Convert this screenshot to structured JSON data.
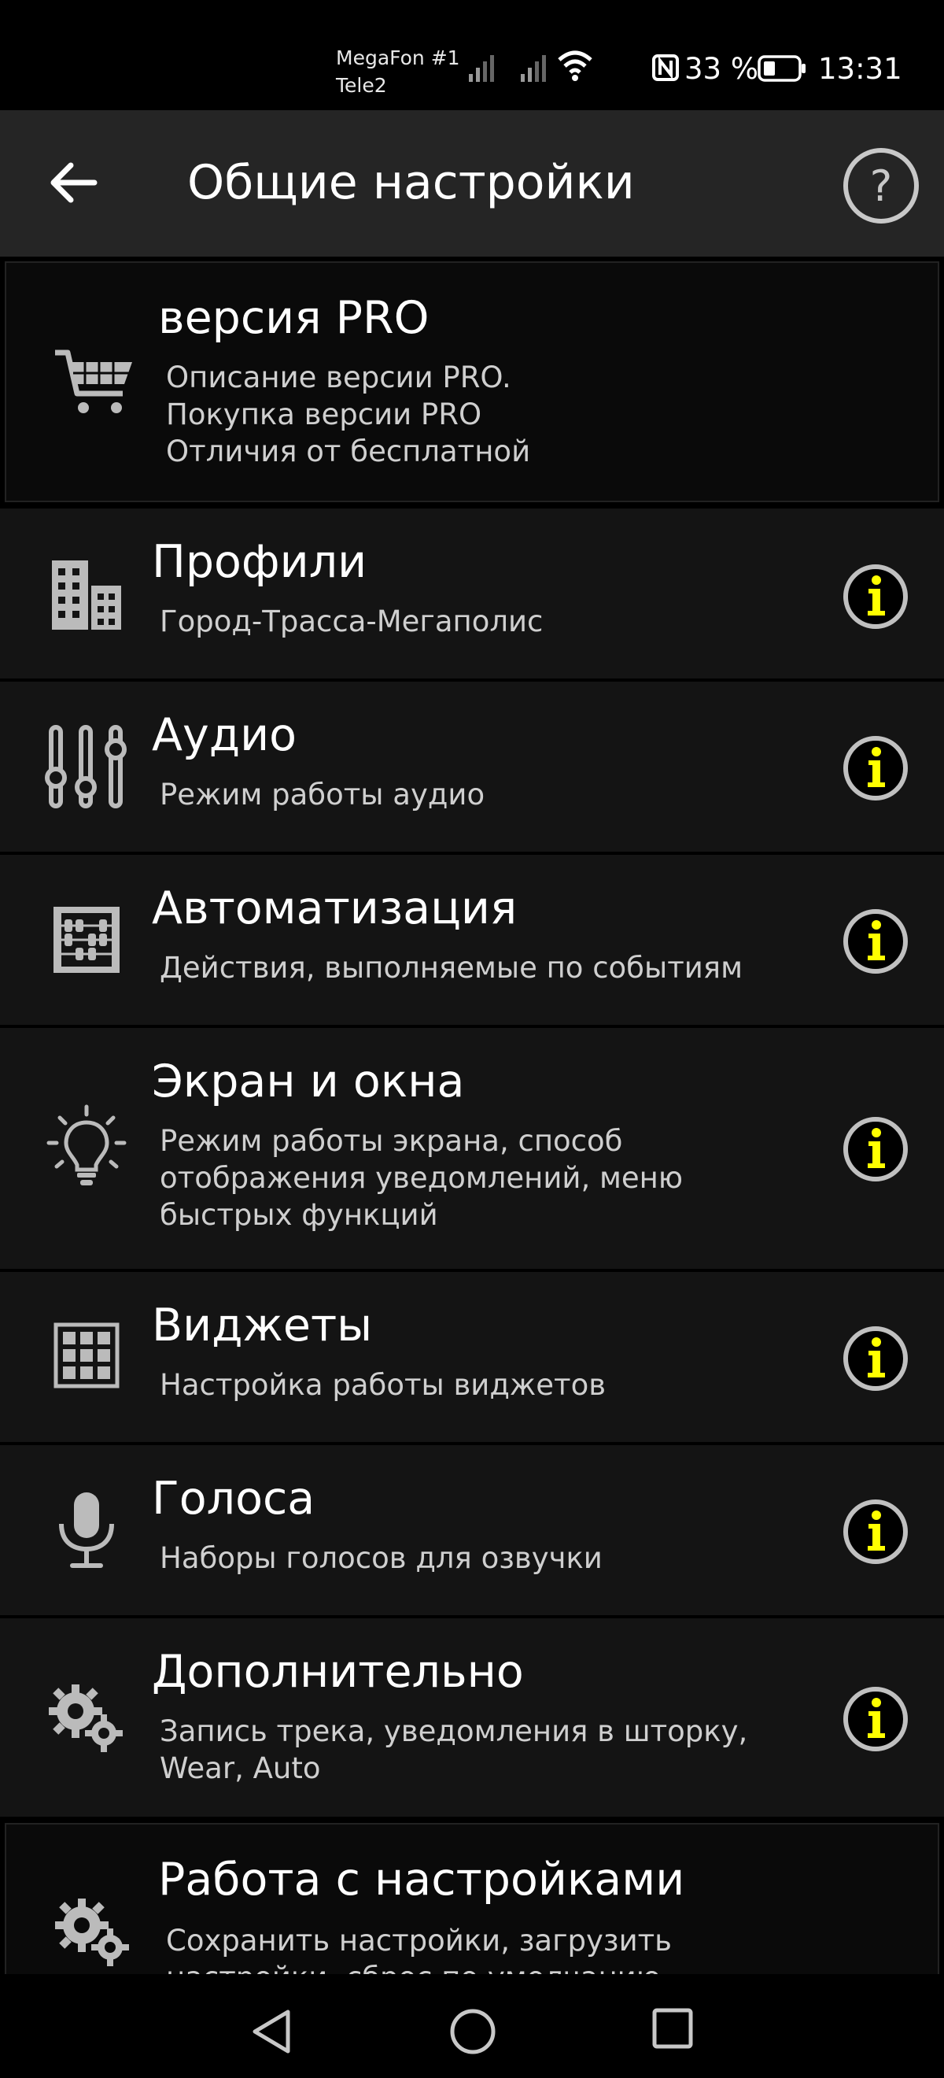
{
  "status_bar": {
    "carrier1": "MegaFon #1",
    "carrier2": "Tele2",
    "battery": "33 %",
    "time": "13:31"
  },
  "app_bar": {
    "title": "Общие настройки",
    "back_icon": "arrow-left-icon",
    "help_icon": "help-circle-icon"
  },
  "colors": {
    "background": "#141414",
    "app_bar": "#252525",
    "info_icon": "#ffff00"
  },
  "items": [
    {
      "icon": "cart-icon",
      "title": "версия PRO",
      "subtitle": "Описание версии PRO.\nПокупка версии PRO\nОтличия от бесплатной"
    },
    {
      "icon": "buildings-icon",
      "title": "Профили",
      "subtitle": "Город-Трасса-Мегаполис"
    },
    {
      "icon": "equalizer-icon",
      "title": "Аудио",
      "subtitle": "Режим работы аудио"
    },
    {
      "icon": "abacus-icon",
      "title": "Автоматизация",
      "subtitle": "Действия, выполняемые по событиям"
    },
    {
      "icon": "lightbulb-icon",
      "title": "Экран и окна",
      "subtitle": "Режим работы экрана, способ\nотображения уведомлений, меню\nбыстрых функций"
    },
    {
      "icon": "grid-icon",
      "title": "Виджеты",
      "subtitle": "Настройка работы виджетов"
    },
    {
      "icon": "microphone-icon",
      "title": "Голоса",
      "subtitle": "Наборы голосов для озвучки"
    },
    {
      "icon": "gears-icon",
      "title": "Дополнительно",
      "subtitle": "Запись трека, уведомления в шторку,\nWear, Auto"
    },
    {
      "icon": "gears-icon",
      "title": "Работа с настройками",
      "subtitle": "Сохранить настройки, загрузить\nнастройки, сброс по умолчанию"
    }
  ],
  "nav_bar": {
    "back": "triangle-back-icon",
    "home": "circle-home-icon",
    "recents": "square-recents-icon"
  }
}
